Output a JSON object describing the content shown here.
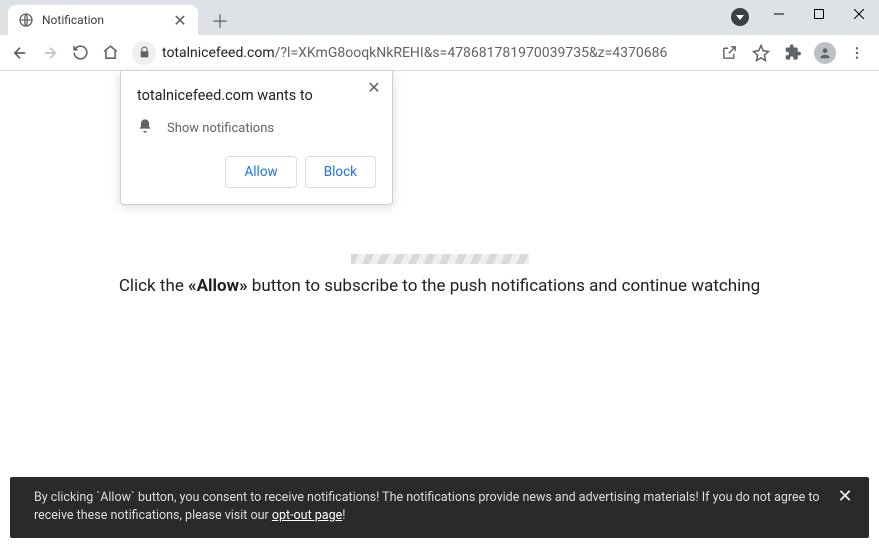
{
  "tab": {
    "title": "Notification"
  },
  "address": {
    "domain": "totalnicefeed.com",
    "path": "/?l=XKmG8ooqkNkREHI&s=478681781970039735&z=4370686"
  },
  "permission_prompt": {
    "title": "totalnicefeed.com wants to",
    "text": "Show notifications",
    "allow": "Allow",
    "block": "Block"
  },
  "page": {
    "message_before": "Click the ",
    "message_strong": "«Allow»",
    "message_after": " button to subscribe to the push notifications and continue watching"
  },
  "consent": {
    "text_before_link": "By clicking `Allow` button, you consent to receive notifications! The notifications provide news and advertising materials! If you do not agree to receive these notifications, please visit our ",
    "link_text": "opt-out page",
    "text_after_link": "!"
  }
}
